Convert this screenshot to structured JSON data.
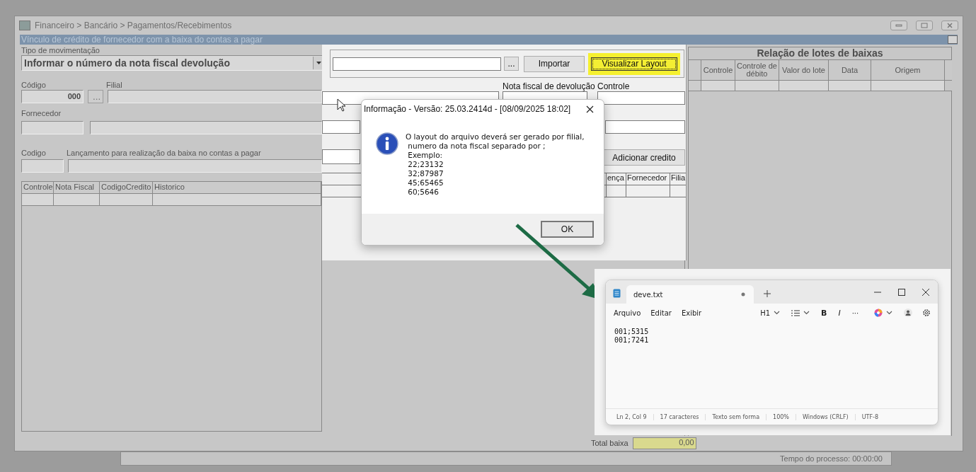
{
  "window": {
    "title": "Financeiro > Bancário > Pagamentos/Recebimentos"
  },
  "form": {
    "title": "Vínculo de crédito de fornecedor com a baixa do contas a pagar",
    "movement_type": {
      "label": "Tipo de  movimentação",
      "value": "Informar o número da nota fiscal devolução"
    },
    "codigo": {
      "label": "Código",
      "value": "000",
      "browse": "..."
    },
    "filial": {
      "label": "Filial"
    },
    "fornecedor": {
      "label": "Fornecedor"
    },
    "lancamento_codigo": {
      "label": "Codigo"
    },
    "lancamento": {
      "label": "Lançamento para realização da baixa no contas a pagar"
    },
    "credits_table": {
      "columns": [
        "Controle",
        "Nota Fiscal",
        "CodigoCredito",
        "Historico"
      ]
    },
    "import": {
      "browse": "...",
      "import_button": "Importar",
      "layout_button": "Visualizar Layout",
      "layout_highlighted": true
    },
    "nota_label": "Nota fiscal de devolução",
    "controle_label": "Controle",
    "add_button": "Adicionar credito",
    "import_table": {
      "columns": [
        "ença",
        "Fornecedor",
        "Filia"
      ]
    },
    "lots": {
      "title": "Relação de lotes de baixas",
      "columns": [
        "Controle",
        "Controle de débito",
        "Valor do lote",
        "Data",
        "Origem"
      ]
    },
    "total": {
      "label": "Total baixa",
      "value": "0,00"
    },
    "process_time": "Tempo do processo: 00:00:00"
  },
  "dialog": {
    "title": "Informação - Versão: 25.03.2414d - [08/09/2025 18:02]",
    "message": [
      "O layout do arquivo deverá ser gerado por filial,",
      " numero da nota fiscal separado por ;",
      " Exemplo:",
      " 22;23132",
      " 32;87987",
      " 45;65465",
      " 60;5646"
    ],
    "ok": "OK"
  },
  "notepad": {
    "tab": "deve.txt",
    "unsaved": true,
    "menu": [
      "Arquivo",
      "Editar",
      "Exibir"
    ],
    "heading": "H1",
    "bold": "B",
    "italic": "I",
    "more": "···",
    "content": [
      "001;5315",
      "001;7241"
    ],
    "status": [
      "Ln 2, Col 9",
      "17 caracteres",
      "Texto sem forma",
      "100%",
      "Windows (CRLF)",
      "UTF-8"
    ]
  }
}
